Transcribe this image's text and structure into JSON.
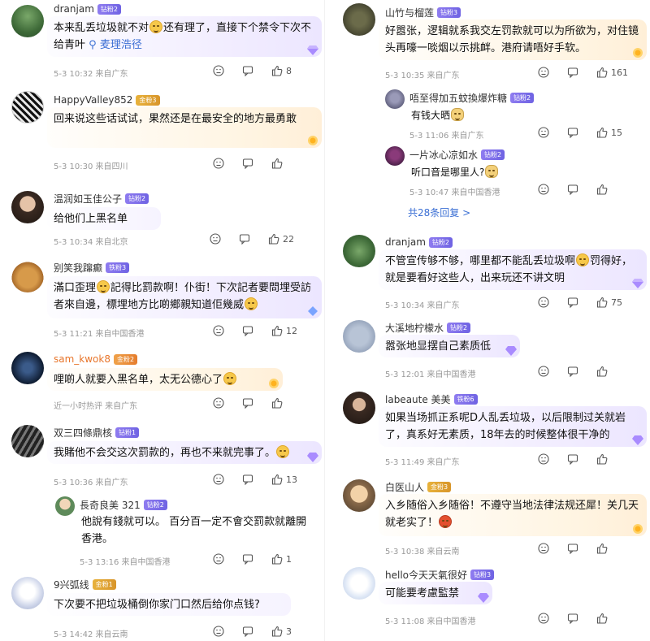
{
  "left": [
    {
      "user": "dranjam",
      "badge": "钻粉2",
      "badge_style": "drill",
      "text_a": "本来乱丢垃圾就不对",
      "text_b": "还有理了，直接下个禁令下次不给青叶",
      "link": "麦理浩径",
      "time": "5-3 10:32 来自广东",
      "likes": "8"
    },
    {
      "user": "HappyValley852",
      "badge": "金粉3",
      "badge_style": "gold",
      "text": "回来说这些话试试，果然还是在最安全的地方最勇敢",
      "time": "5-3 10:30 来自四川",
      "likes": ""
    },
    {
      "user": "温润如玉佳公子",
      "badge": "钻粉2",
      "badge_style": "drill",
      "text": "给他们上黑名单",
      "time": "5-3 10:34 来自北京",
      "likes": "22"
    },
    {
      "user": "别笑我蹿癫",
      "badge": "铁粉3",
      "badge_style": "drill",
      "text_a": "滿口歪理",
      "text_b": "記得比罰款啊！仆街！下次記者要問埋受訪者來自邊，標埋地方比啲鄉親知道佢幾威",
      "time": "5-3 11:21 来自中国香港",
      "likes": "12"
    },
    {
      "user": "sam_kwok8",
      "badge": "金粉2",
      "badge_style": "orange",
      "text_a": "哩啲人就要入黑名单，太无公德心了",
      "time": "近一小时热评 来自广东",
      "likes": ""
    },
    {
      "user": "双三四條鼎核",
      "badge": "钻粉1",
      "badge_style": "drill",
      "text_a": "我賭他不会交这次罰款的，再也不来就完事了。",
      "time": "5-3 10:36 来自广东",
      "likes": "13",
      "reply": {
        "user": "長奇良美 321",
        "badge": "钻粉2",
        "text": "他說有錢就可以。 百分百一定不會交罰款就離開香港。",
        "time": "5-3 13:16 来自中国香港",
        "likes": "1"
      }
    },
    {
      "user": "9兴弧线",
      "badge": "金粉1",
      "badge_style": "gold",
      "text": "下次要不把垃圾桶倒你家门口然后给你点钱?",
      "time": "5-3 14:42 来自云南",
      "likes": "3"
    }
  ],
  "right": [
    {
      "user": "山竹与榴莲",
      "badge": "钻粉3",
      "badge_style": "drill",
      "text": "好嚣张，逻辑就系我交左罚款就可以为所欲为，对住镜头再嚎一啖烟以示挑衅。港府请唔好手软。",
      "time": "5-3 10:35 来自广东",
      "likes": "161",
      "replies": [
        {
          "user": "唔至得加五蚊換爆炸糖",
          "badge": "钻粉2",
          "text": "有钱大晒",
          "time": "5-3 11:06 来自广东",
          "likes": "15"
        },
        {
          "user": "一片冰心凉如水",
          "badge": "钻粉2",
          "text": "听口音是哪里人?",
          "time": "5-3 10:47 来自中国香港",
          "likes": ""
        }
      ],
      "more": "共28条回复 >"
    },
    {
      "user": "dranjam",
      "badge": "钻粉2",
      "badge_style": "drill",
      "text_a": "不管宣传够不够，哪里都不能乱丢垃圾啊",
      "text_b": "罚得好，就是要看好这些人，出来玩还不讲文明",
      "time": "5-3 10:34 来自广东",
      "likes": "75"
    },
    {
      "user": "大溪地柠檬水",
      "badge": "钻粉2",
      "badge_style": "drill",
      "text": "嚣张地显摆自己素质低",
      "time": "5-3 12:01 来自中国香港",
      "likes": ""
    },
    {
      "user": "labeaute 美美",
      "badge": "铁粉6",
      "badge_style": "drill",
      "text": "如果当场抓正系呢D人乱丢垃圾，以后限制过关就岩了，真系好无素质，18年去的时候整体很干净的",
      "time": "5-3 11:49 来自广东",
      "likes": ""
    },
    {
      "user": "白医山人",
      "badge": "金粉3",
      "badge_style": "gold",
      "text_a": "入乡随俗入乡随俗！不遵守当地法律法规还犀！关几天就老实了！",
      "time": "5-3 10:38 来自云南",
      "likes": ""
    },
    {
      "user": "hello今天天氣很好",
      "badge": "钻粉3",
      "badge_style": "drill",
      "text": "可能要考慮監禁",
      "time": "5-3 11:08 来自中国香港",
      "likes": ""
    }
  ]
}
